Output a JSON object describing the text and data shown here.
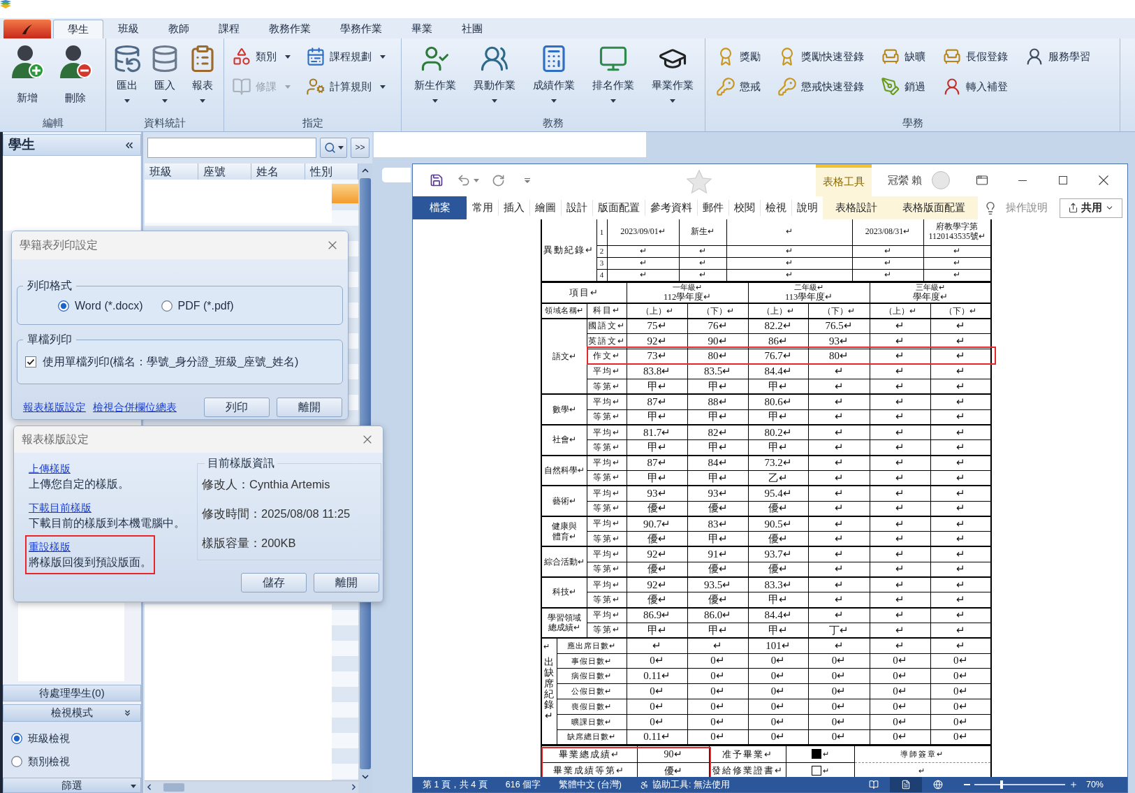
{
  "app": {
    "tabs": [
      {
        "label": "學生",
        "selected": true
      },
      {
        "label": "班級",
        "selected": false
      },
      {
        "label": "教師",
        "selected": false
      },
      {
        "label": "課程",
        "selected": false
      },
      {
        "label": "教務作業",
        "selected": false
      },
      {
        "label": "學務作業",
        "selected": false
      },
      {
        "label": "畢業",
        "selected": false
      },
      {
        "label": "社團",
        "selected": false
      }
    ],
    "ribbon": [
      {
        "label": "編輯",
        "kind": "large",
        "items": [
          {
            "label": "新增",
            "has_menu": false
          },
          {
            "label": "刪除",
            "has_menu": false
          }
        ]
      },
      {
        "label": "資料統計",
        "kind": "large",
        "items": [
          {
            "label": "匯出",
            "has_menu": true
          },
          {
            "label": "匯入",
            "has_menu": true
          },
          {
            "label": "報表",
            "has_menu": true
          }
        ]
      },
      {
        "label": "指定",
        "kind": "small",
        "items": [
          {
            "label": "類別",
            "has_menu": true,
            "disabled": false
          },
          {
            "label": "修課",
            "has_menu": true,
            "disabled": true
          },
          {
            "label": "課程規劃",
            "has_menu": true,
            "disabled": false
          },
          {
            "label": "計算規則",
            "has_menu": true,
            "disabled": false
          }
        ]
      },
      {
        "label": "教務",
        "kind": "large",
        "items": [
          {
            "label": "新生作業",
            "has_menu": true
          },
          {
            "label": "異動作業",
            "has_menu": true
          },
          {
            "label": "成績作業",
            "has_menu": true
          },
          {
            "label": "排名作業",
            "has_menu": true
          },
          {
            "label": "畢業作業",
            "has_menu": true
          }
        ]
      },
      {
        "label": "學務",
        "kind": "small",
        "items": [
          {
            "label": "獎勵"
          },
          {
            "label": "懲戒"
          },
          {
            "label": "獎勵快速登錄"
          },
          {
            "label": "懲戒快速登錄"
          },
          {
            "label": "缺曠"
          },
          {
            "label": "銷過"
          },
          {
            "label": "長假登錄"
          },
          {
            "label": "轉入補登"
          },
          {
            "label": "服務學習"
          }
        ]
      }
    ]
  },
  "sidebar": {
    "title": "學生",
    "pending": "待處理學生(0)",
    "view_mode": {
      "title": "檢視模式",
      "options": [
        {
          "label": "班級檢視",
          "selected": true
        },
        {
          "label": "類別檢視",
          "selected": false
        }
      ]
    },
    "filter": "篩選"
  },
  "student_list": {
    "more": ">>",
    "columns": [
      "班級",
      "座號",
      "姓名",
      "性別"
    ]
  },
  "word": {
    "context_title": "表格工具",
    "user": "冠縈 賴",
    "tabs": [
      {
        "label": "檔案",
        "kind": "file"
      },
      {
        "label": "常用",
        "kind": "main"
      },
      {
        "label": "插入",
        "kind": "main"
      },
      {
        "label": "繪圖",
        "kind": "main"
      },
      {
        "label": "設計",
        "kind": "main"
      },
      {
        "label": "版面配置",
        "kind": "main"
      },
      {
        "label": "參考資料",
        "kind": "main"
      },
      {
        "label": "郵件",
        "kind": "main"
      },
      {
        "label": "校閱",
        "kind": "main"
      },
      {
        "label": "檢視",
        "kind": "main"
      },
      {
        "label": "說明",
        "kind": "main"
      },
      {
        "label": "表格設計",
        "kind": "context"
      },
      {
        "label": "表格版面配置",
        "kind": "context"
      }
    ],
    "tell_me": "操作說明",
    "share": "共用",
    "document": {
      "transfer": {
        "label": "異動紀錄↵",
        "rows": [
          {
            "index": "1",
            "cells": [
              "2023/09/01↵",
              "新生↵",
              "↵",
              "2023/08/31↵",
              "府教學字第1120143535號↵"
            ]
          },
          {
            "index": "2",
            "cells": [
              "↵",
              "↵",
              "↵",
              "↵",
              "↵"
            ]
          },
          {
            "index": "3",
            "cells": [
              "↵",
              "↵",
              "↵",
              "↵",
              "↵"
            ]
          },
          {
            "index": "4",
            "cells": [
              "↵",
              "↵",
              "↵",
              "↵",
              "↵"
            ]
          }
        ]
      },
      "header": {
        "item": "項目↵",
        "years": [
          [
            "一年級↵",
            "112學年度↵"
          ],
          [
            "二年級↵",
            "113學年度↵"
          ],
          [
            "三年級↵",
            "學年度↵"
          ]
        ],
        "area": "領域名稱↵",
        "subject": "科目↵",
        "terms": [
          "（上）↵",
          "（下）↵",
          "（上）↵",
          "（下）↵",
          "（上）↵",
          "（下）↵"
        ]
      },
      "areas": [
        {
          "name": "語文↵",
          "rows": [
            {
              "subject": "國語文↵",
              "values": [
                "75↵",
                "76↵",
                "82.2↵",
                "76.5↵",
                "↵",
                "↵"
              ],
              "highlighted": false
            },
            {
              "subject": "英語文↵",
              "values": [
                "92↵",
                "90↵",
                "86↵",
                "93↵",
                "↵",
                "↵"
              ],
              "highlighted": false
            },
            {
              "subject": "作文↵",
              "values": [
                "73↵",
                "80↵",
                "76.7↵",
                "80↵",
                "↵",
                "↵"
              ],
              "highlighted": true
            },
            {
              "subject": "平均↵",
              "values": [
                "83.8↵",
                "83.5↵",
                "84.4↵",
                "↵",
                "↵",
                "↵"
              ],
              "highlighted": false
            },
            {
              "subject": "等第↵",
              "values": [
                "甲↵",
                "甲↵",
                "甲↵",
                "↵",
                "↵",
                "↵"
              ],
              "highlighted": false
            }
          ]
        },
        {
          "name": "數學↵",
          "rows": [
            {
              "subject": "平均↵",
              "values": [
                "87↵",
                "88↵",
                "80.6↵",
                "↵",
                "↵",
                "↵"
              ],
              "highlighted": false
            },
            {
              "subject": "等第↵",
              "values": [
                "甲↵",
                "甲↵",
                "甲↵",
                "↵",
                "↵",
                "↵"
              ],
              "highlighted": false
            }
          ]
        },
        {
          "name": "社會↵",
          "rows": [
            {
              "subject": "平均↵",
              "values": [
                "81.7↵",
                "82↵",
                "80.2↵",
                "↵",
                "↵",
                "↵"
              ],
              "highlighted": false
            },
            {
              "subject": "等第↵",
              "values": [
                "甲↵",
                "甲↵",
                "甲↵",
                "↵",
                "↵",
                "↵"
              ],
              "highlighted": false
            }
          ]
        },
        {
          "name": "自然科學↵",
          "rows": [
            {
              "subject": "平均↵",
              "values": [
                "87↵",
                "84↵",
                "73.2↵",
                "↵",
                "↵",
                "↵"
              ],
              "highlighted": false
            },
            {
              "subject": "等第↵",
              "values": [
                "甲↵",
                "甲↵",
                "乙↵",
                "↵",
                "↵",
                "↵"
              ],
              "highlighted": false
            }
          ]
        },
        {
          "name": "藝術↵",
          "rows": [
            {
              "subject": "平均↵",
              "values": [
                "93↵",
                "93↵",
                "95.4↵",
                "↵",
                "↵",
                "↵"
              ],
              "highlighted": false
            },
            {
              "subject": "等第↵",
              "values": [
                "優↵",
                "優↵",
                "優↵",
                "↵",
                "↵",
                "↵"
              ],
              "highlighted": false
            }
          ]
        },
        {
          "name": "健康與體育↵",
          "rows": [
            {
              "subject": "平均↵",
              "values": [
                "90.7↵",
                "83↵",
                "90.5↵",
                "↵",
                "↵",
                "↵"
              ],
              "highlighted": false
            },
            {
              "subject": "等第↵",
              "values": [
                "優↵",
                "甲↵",
                "優↵",
                "↵",
                "↵",
                "↵"
              ],
              "highlighted": false
            }
          ]
        },
        {
          "name": "綜合活動↵",
          "rows": [
            {
              "subject": "平均↵",
              "values": [
                "92↵",
                "91↵",
                "93.7↵",
                "↵",
                "↵",
                "↵"
              ],
              "highlighted": false
            },
            {
              "subject": "等第↵",
              "values": [
                "優↵",
                "優↵",
                "優↵",
                "↵",
                "↵",
                "↵"
              ],
              "highlighted": false
            }
          ]
        },
        {
          "name": "科技↵",
          "rows": [
            {
              "subject": "平均↵",
              "values": [
                "92↵",
                "93.5↵",
                "83.3↵",
                "↵",
                "↵",
                "↵"
              ],
              "highlighted": false
            },
            {
              "subject": "等第↵",
              "values": [
                "優↵",
                "優↵",
                "甲↵",
                "↵",
                "↵",
                "↵"
              ],
              "highlighted": false
            }
          ]
        },
        {
          "name": "學習領域總成績↵",
          "rows": [
            {
              "subject": "平均↵",
              "values": [
                "86.9↵",
                "86.0↵",
                "84.4↵",
                "↵",
                "↵",
                "↵"
              ],
              "highlighted": false
            },
            {
              "subject": "等第↵",
              "values": [
                "甲↵",
                "甲↵",
                "甲↵",
                "丁↵",
                "↵",
                "↵"
              ],
              "highlighted": false
            }
          ]
        }
      ],
      "attendance": {
        "lead": "↵",
        "label": "出缺席紀錄↵",
        "rows": [
          {
            "item": "應出席日數↵",
            "values": [
              "↵",
              "↵",
              "101↵",
              "↵",
              "↵",
              "↵"
            ]
          },
          {
            "item": "事假日數↵",
            "values": [
              "0↵",
              "0↵",
              "0↵",
              "0↵",
              "0↵",
              "0↵"
            ]
          },
          {
            "item": "病假日數↵",
            "values": [
              "0.11↵",
              "0↵",
              "0↵",
              "0↵",
              "0↵",
              "0↵"
            ]
          },
          {
            "item": "公假日數↵",
            "values": [
              "0↵",
              "0↵",
              "0↵",
              "0↵",
              "0↵",
              "0↵"
            ]
          },
          {
            "item": "喪假日數↵",
            "values": [
              "0↵",
              "0↵",
              "0↵",
              "0↵",
              "0↵",
              "0↵"
            ]
          },
          {
            "item": "曠課日數↵",
            "values": [
              "0↵",
              "0↵",
              "0↵",
              "0↵",
              "0↵",
              "0↵"
            ]
          },
          {
            "item": "缺席總日數↵",
            "values": [
              "0.11↵",
              "0↵",
              "0↵",
              "0↵",
              "0↵",
              "0↵"
            ]
          }
        ]
      },
      "graduation": {
        "highlighted": true,
        "rows": [
          {
            "label": "畢業總成績↵",
            "value": "90↵",
            "item": "准予畢業↵",
            "checked": true,
            "mark": "↵",
            "note": "導師簽章↵"
          },
          {
            "label": "畢業成績等第↵",
            "value": "優↵",
            "item": "發給修業證書↵",
            "checked": false,
            "mark": "↵",
            "note": "↵"
          }
        ]
      }
    },
    "status_bar": {
      "items": [
        "第 1 頁，共 4 頁",
        "616 個字",
        "繁體中文 (台灣)",
        "協助工具: 無法使用"
      ],
      "views": [
        {
          "selected": false
        },
        {
          "selected": true
        },
        {
          "selected": false
        }
      ],
      "zoom": {
        "level": 0.3,
        "reading": "70%"
      }
    }
  },
  "print_dialog": {
    "title": "學籍表列印設定",
    "format": {
      "label": "列印格式",
      "options": [
        {
          "label": "Word (*.docx)",
          "selected": true
        },
        {
          "label": "PDF (*.pdf)",
          "selected": false
        }
      ]
    },
    "single_file": {
      "label": "單檔列印",
      "checkbox": {
        "label": "使用單檔列印(檔名：學號_身分證_班級_座號_姓名)",
        "checked": true
      }
    },
    "links": [
      "報表樣版設定",
      "檢視合併欄位總表"
    ],
    "buttons": [
      "列印",
      "離開"
    ]
  },
  "template_dialog": {
    "title": "報表樣版設定",
    "actions": [
      {
        "link": "上傳樣版",
        "description": "上傳您自定的樣版。",
        "highlighted": false
      },
      {
        "link": "下載目前樣版",
        "description": "下載目前的樣版到本機電腦中。",
        "highlighted": false
      },
      {
        "link": "重設樣版",
        "description": "將樣版回復到預設版面。",
        "highlighted": true
      }
    ],
    "info": {
      "title": "目前樣版資訊",
      "lines": [
        "修改人：Cynthia Artemis",
        "修改時間：2025/08/08 11:25",
        "樣版容量：200KB"
      ]
    },
    "buttons": [
      "儲存",
      "離開"
    ]
  }
}
